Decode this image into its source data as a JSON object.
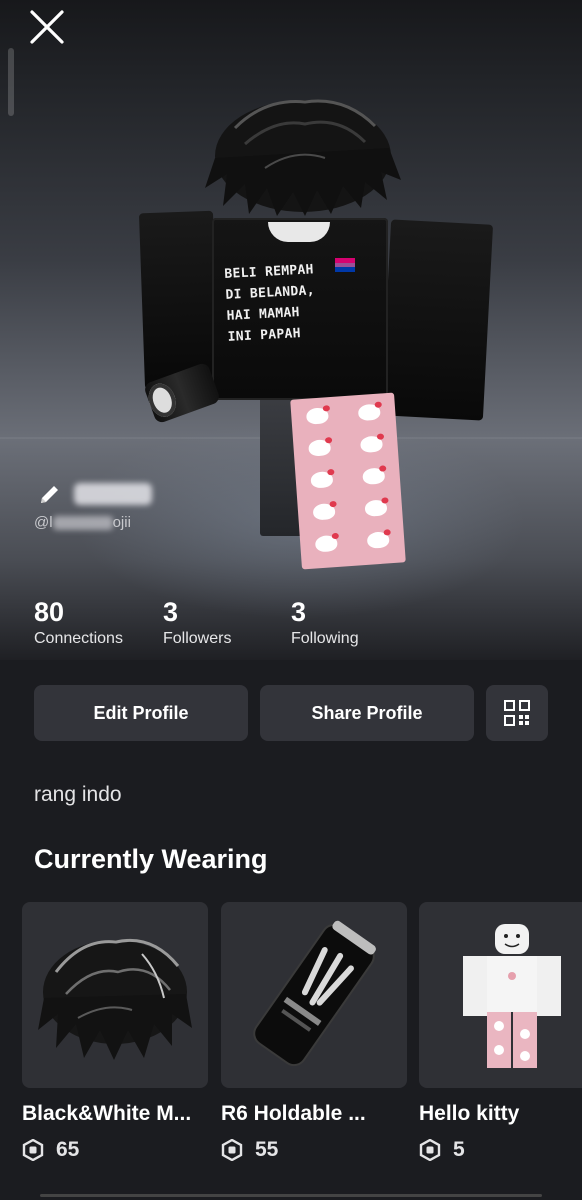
{
  "profile": {
    "handle_prefix": "@l",
    "handle_suffix": "ojii",
    "shirt_text": "BELI REMPAH\nDI BELANDA,\nHAI MAMAH\nINI PAPAH",
    "bio": "rang indo"
  },
  "stats": [
    {
      "value": "80",
      "label": "Connections"
    },
    {
      "value": "3",
      "label": "Followers"
    },
    {
      "value": "3",
      "label": "Following"
    }
  ],
  "actions": {
    "edit_label": "Edit Profile",
    "share_label": "Share Profile"
  },
  "wearing": {
    "title": "Currently Wearing",
    "items": [
      {
        "name": "Black&White M...",
        "price": "65",
        "icon": "hair-icon"
      },
      {
        "name": "R6 Holdable ...",
        "price": "55",
        "icon": "energy-drink-can-icon"
      },
      {
        "name": "Hello kitty",
        "price": "5",
        "icon": "avatar-outfit-icon"
      }
    ]
  },
  "icons": {
    "close": "close-icon",
    "edit_name": "pencil-icon",
    "qr": "qr-code-icon",
    "currency": "robux-icon"
  },
  "colors": {
    "background": "#1b1c20",
    "button": "#33343a",
    "card": "#2f3035"
  }
}
